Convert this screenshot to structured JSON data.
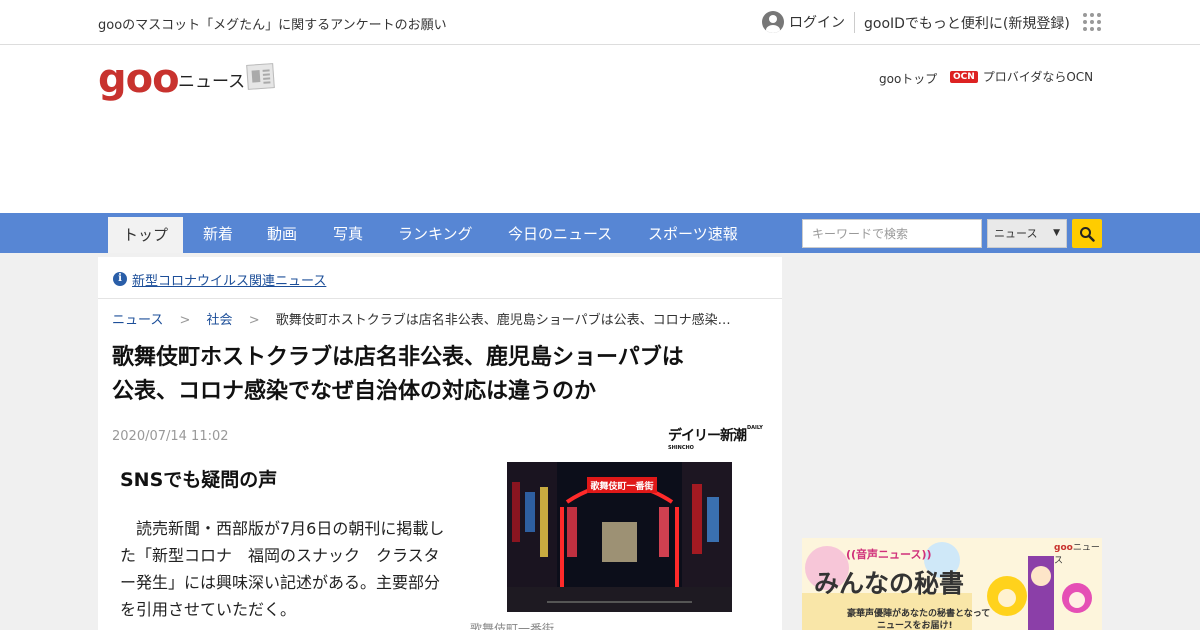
{
  "util_bar": {
    "notice": "gooのマスコット「メグたん」に関するアンケートのお願い",
    "login_label": "ログイン",
    "register_label": "gooIDでもっと便利に(新規登録)"
  },
  "header": {
    "logo_text": "goo",
    "logo_sub": "ニュース",
    "goo_top_label": "gooトップ",
    "ocn_badge": "OCN",
    "ocn_label": "プロバイダならOCN"
  },
  "nav": {
    "tabs": [
      {
        "label": "トップ",
        "active": true
      },
      {
        "label": "新着"
      },
      {
        "label": "動画"
      },
      {
        "label": "写真"
      },
      {
        "label": "ランキング"
      },
      {
        "label": "今日のニュース"
      },
      {
        "label": "スポーツ速報"
      }
    ],
    "search_placeholder": "キーワードで検索",
    "search_scope": "ニュース"
  },
  "covid_link": "新型コロナウイルス関連ニュース",
  "breadcrumb": {
    "items": [
      "ニュース",
      "社会"
    ],
    "current": "歌舞伎町ホストクラブは店名非公表、鹿児島ショーパブは公表、コロナ感染…"
  },
  "article": {
    "title_line1": "歌舞伎町ホストクラブは店名非公表、鹿児島ショーパブは",
    "title_line2": "公表、コロナ感染でなぜ自治体の対応は違うのか",
    "date": "2020/07/14 11:02",
    "source_logo": "デイリー新潮",
    "source_logo_small": "DAILY SHINCHO",
    "section_heading": "SNSでも疑問の声",
    "body": "読売新聞・西部版が7月6日の朝刊に掲載した「新型コロナ　福岡のスナック　クラスター発生」には興味深い記述がある。主要部分を引用させていただく。",
    "photo_sign": "歌舞伎町一番街",
    "photo_caption": "歌舞伎町一番街"
  },
  "ad": {
    "brand": "goo",
    "brand_suffix": "ニュース",
    "tag": "((音声ニュース))",
    "title": "みんなの秘書",
    "sub1": "豪華声優陣があなたの秘書となって",
    "sub2": "ニュースをお届け!"
  }
}
